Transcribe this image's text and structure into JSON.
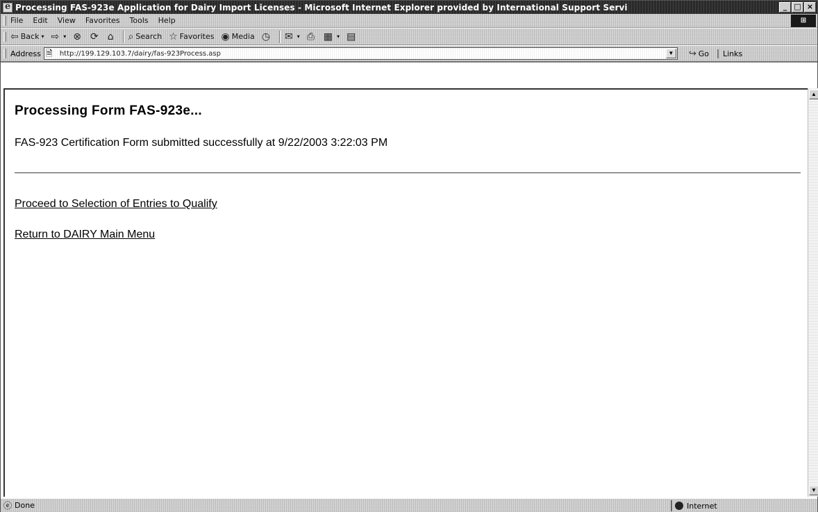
{
  "window": {
    "title": "Processing FAS-923e Application for Dairy Import Licenses - Microsoft Internet Explorer provided by International Support Servi"
  },
  "menu": {
    "items": [
      "File",
      "Edit",
      "View",
      "Favorites",
      "Tools",
      "Help"
    ]
  },
  "toolbar": {
    "back_label": "Back",
    "search_label": "Search",
    "favorites_label": "Favorites",
    "media_label": "Media"
  },
  "address": {
    "label": "Address",
    "url": "http://199.129.103.7/dairy/fas-923Process.asp",
    "go_label": "Go",
    "links_label": "Links"
  },
  "page": {
    "heading": "Processing Form FAS-923e...",
    "status_message": "FAS-923 Certification Form submitted successfully at 9/22/2003 3:22:03 PM",
    "links": [
      "Proceed to Selection of Entries to Qualify",
      "Return to DAIRY Main Menu"
    ]
  },
  "statusbar": {
    "status": "Done",
    "zone": "Internet"
  }
}
